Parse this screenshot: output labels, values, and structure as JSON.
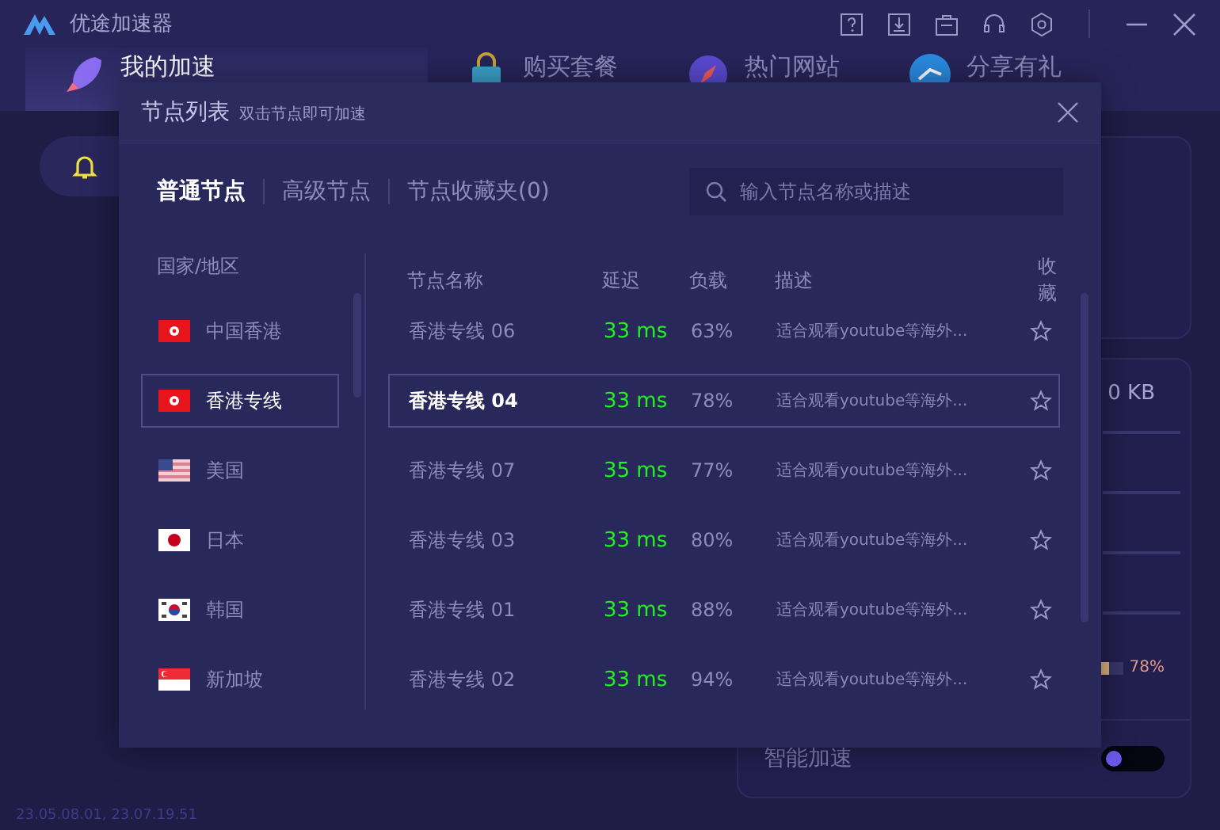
{
  "window": {
    "title": "优途加速器"
  },
  "main_tabs": [
    {
      "label": "我的加速",
      "selected": true,
      "kind": "rocket"
    },
    {
      "label": "购买套餐",
      "selected": false,
      "kind": "bag"
    },
    {
      "label": "热门网站",
      "selected": false,
      "kind": "compass"
    },
    {
      "label": "分享有礼",
      "selected": false,
      "kind": "share"
    }
  ],
  "stats_panel": {
    "traffic": "0 KB",
    "load": {
      "level": 0.78,
      "reading": "78%"
    },
    "smart_boost": {
      "label": "智能加速",
      "on": false
    }
  },
  "version": "23.05.08.01, 23.07.19.51",
  "node_dialog": {
    "title": "节点列表",
    "subtitle": "双击节点即可加速",
    "tabs": [
      {
        "label": "普通节点",
        "selected": true
      },
      {
        "label": "高级节点",
        "selected": false
      },
      {
        "label": "节点收藏夹(0)",
        "selected": false
      }
    ],
    "search": {
      "placeholder": "输入节点名称或描述"
    },
    "region_header": "国家/地区",
    "regions": [
      {
        "name": "中国香港",
        "kind": "hk",
        "selected": false
      },
      {
        "name": "香港专线",
        "kind": "hk",
        "selected": true
      },
      {
        "name": "美国",
        "kind": "us",
        "selected": false
      },
      {
        "name": "日本",
        "kind": "jp",
        "selected": false
      },
      {
        "name": "韩国",
        "kind": "kr",
        "selected": false
      },
      {
        "name": "新加坡",
        "kind": "sg",
        "selected": false
      }
    ],
    "columns": [
      "节点名称",
      "延迟",
      "负载",
      "描述",
      "收藏"
    ],
    "nodes": [
      {
        "name": "香港专线 06",
        "latency": "33 ms",
        "load": "63%",
        "description": "适合观看youtube等海外...",
        "favorite": false,
        "selected": false
      },
      {
        "name": "香港专线 04",
        "latency": "33 ms",
        "load": "78%",
        "description": "适合观看youtube等海外...",
        "favorite": false,
        "selected": true
      },
      {
        "name": "香港专线 07",
        "latency": "35 ms",
        "load": "77%",
        "description": "适合观看youtube等海外...",
        "favorite": false,
        "selected": false
      },
      {
        "name": "香港专线 03",
        "latency": "33 ms",
        "load": "80%",
        "description": "适合观看youtube等海外...",
        "favorite": false,
        "selected": false
      },
      {
        "name": "香港专线 01",
        "latency": "33 ms",
        "load": "88%",
        "description": "适合观看youtube等海外...",
        "favorite": false,
        "selected": false
      },
      {
        "name": "香港专线 02",
        "latency": "33 ms",
        "load": "94%",
        "description": "适合观看youtube等海外...",
        "favorite": false,
        "selected": false
      }
    ]
  }
}
